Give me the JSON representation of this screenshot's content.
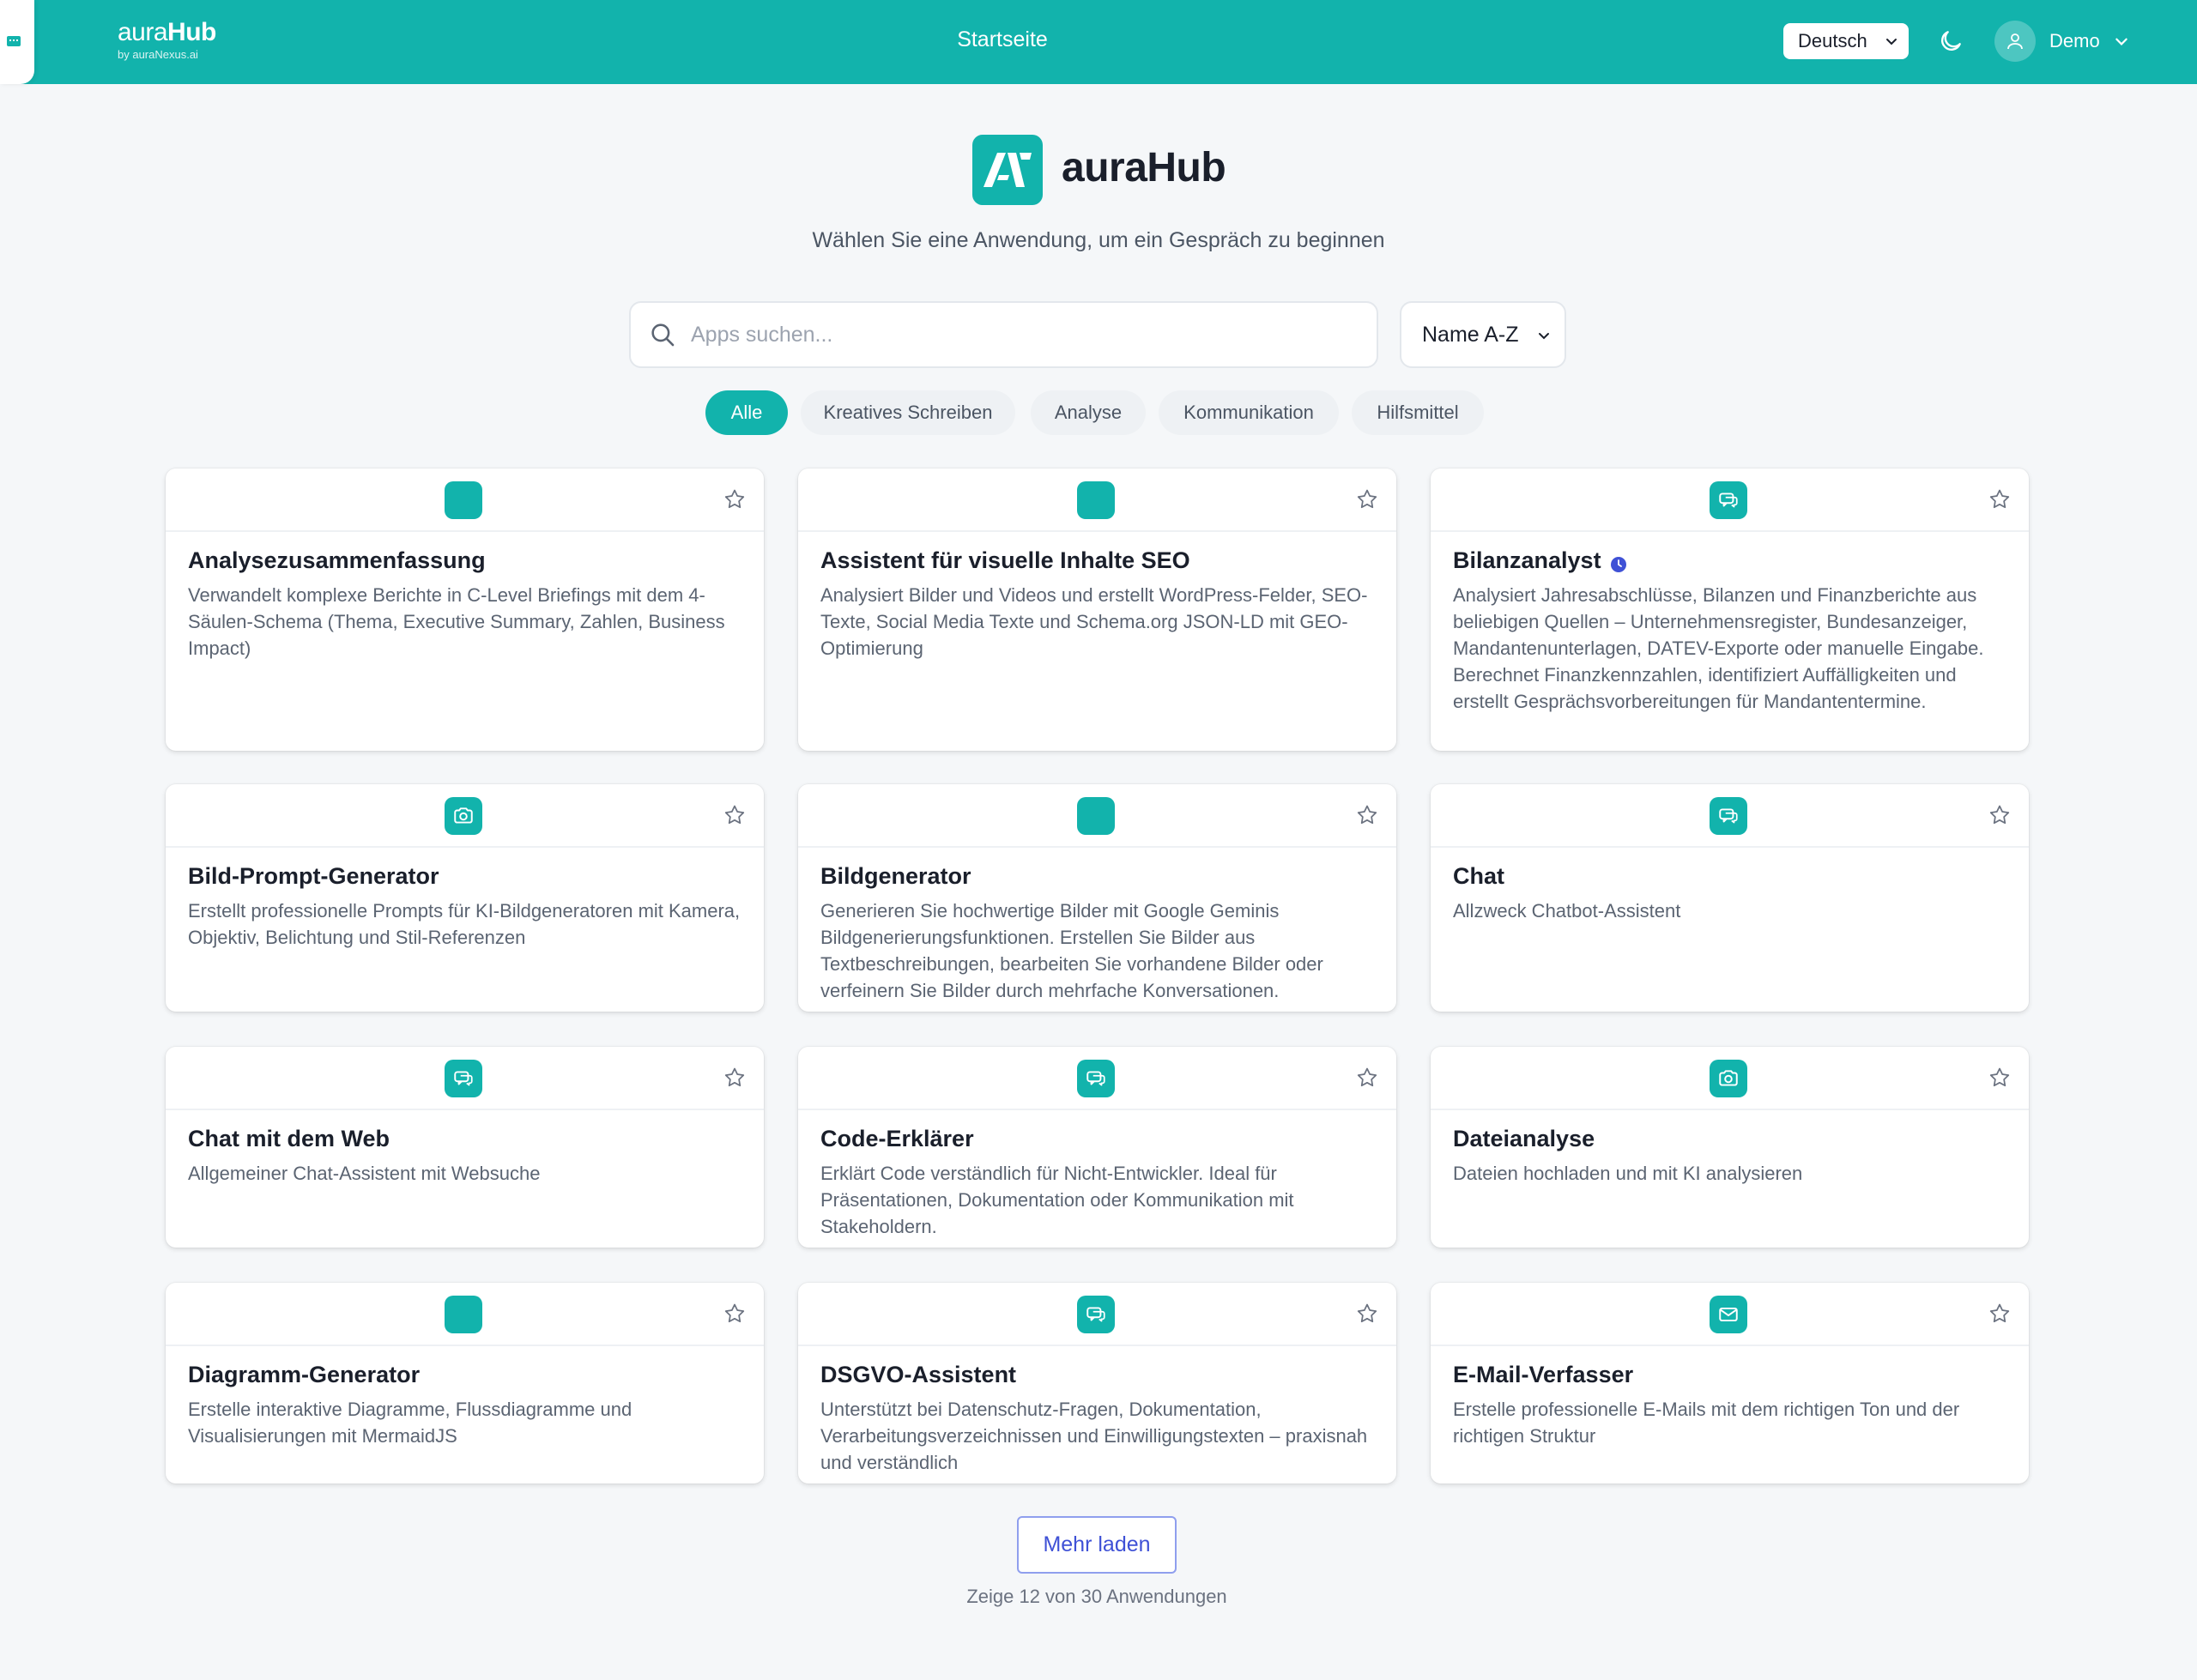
{
  "header": {
    "brand_prefix": "aura",
    "brand_bold": "Hub",
    "brand_sub": "by auraNexus.ai",
    "title": "Startseite",
    "language": "Deutsch",
    "user_name": "Demo"
  },
  "hero": {
    "title": "auraHub",
    "subtitle": "Wählen Sie eine Anwendung, um ein Gespräch zu beginnen"
  },
  "search": {
    "placeholder": "Apps suchen...",
    "sort_label": "Name A-Z"
  },
  "filters": [
    "Alle",
    "Kreatives Schreiben",
    "Analyse",
    "Kommunikation",
    "Hilfsmittel"
  ],
  "filter_active": "Alle",
  "cards": [
    {
      "title": "Analysezusammenfassung",
      "icon": "blank-app-icon",
      "desc": "Verwandelt komplexe Berichte in C-Level Briefings mit dem 4-Säulen-Schema (Thema, Executive Summary, Zahlen, Business Impact)"
    },
    {
      "title": "Assistent für visuelle Inhalte SEO",
      "icon": "blank-app-icon",
      "desc": "Analysiert Bilder und Videos und erstellt WordPress-Felder, SEO-Texte, Social Media Texte und Schema.org JSON-LD mit GEO-Optimierung"
    },
    {
      "title": "Bilanzanalyst",
      "icon": "chat-icon",
      "badge": "clock-badge-icon",
      "desc": "Analysiert Jahresabschlüsse, Bilanzen und Finanzberichte aus beliebigen Quellen – Unternehmensregister, Bundesanzeiger, Mandantenunterlagen, DATEV-Exporte oder manuelle Eingabe. Berechnet Finanzkennzahlen, identifiziert Auffälligkeiten und erstellt Gesprächsvorbereitungen für Mandantentermine."
    },
    {
      "title": "Bild-Prompt-Generator",
      "icon": "camera-icon",
      "desc": "Erstellt professionelle Prompts für KI-Bildgeneratoren mit Kamera, Objektiv, Belichtung und Stil-Referenzen"
    },
    {
      "title": "Bildgenerator",
      "icon": "blank-app-icon",
      "desc": "Generieren Sie hochwertige Bilder mit Google Geminis Bildgenerierungsfunktionen. Erstellen Sie Bilder aus Textbeschreibungen, bearbeiten Sie vorhandene Bilder oder verfeinern Sie Bilder durch mehrfache Konversationen."
    },
    {
      "title": "Chat",
      "icon": "chat-icon",
      "desc": "Allzweck Chatbot-Assistent"
    },
    {
      "title": "Chat mit dem Web",
      "icon": "chat-icon",
      "desc": "Allgemeiner Chat-Assistent mit Websuche"
    },
    {
      "title": "Code-Erklärer",
      "icon": "chat-icon",
      "desc": "Erklärt Code verständlich für Nicht-Entwickler. Ideal für Präsentationen, Dokumentation oder Kommunikation mit Stakeholdern."
    },
    {
      "title": "Dateianalyse",
      "icon": "camera-icon",
      "desc": "Dateien hochladen und mit KI analysieren"
    },
    {
      "title": "Diagramm-Generator",
      "icon": "blank-app-icon",
      "desc": "Erstelle interaktive Diagramme, Flussdiagramme und Visualisierungen mit MermaidJS"
    },
    {
      "title": "DSGVO-Assistent",
      "icon": "chat-icon",
      "desc": "Unterstützt bei Datenschutz-Fragen, Dokumentation, Verarbeitungsverzeichnissen und Einwilligungstexten – praxisnah und verständlich"
    },
    {
      "title": "E-Mail-Verfasser",
      "icon": "mail-icon",
      "desc": "Erstelle professionelle E-Mails mit dem richtigen Ton und der richtigen Struktur"
    }
  ],
  "footer": {
    "load_more": "Mehr laden",
    "count_text": "Zeige 12 von 30 Anwendungen"
  },
  "colors": {
    "accent": "#12b3ac",
    "badge": "#3f51d6",
    "page_bg": "#f5f7f9"
  }
}
